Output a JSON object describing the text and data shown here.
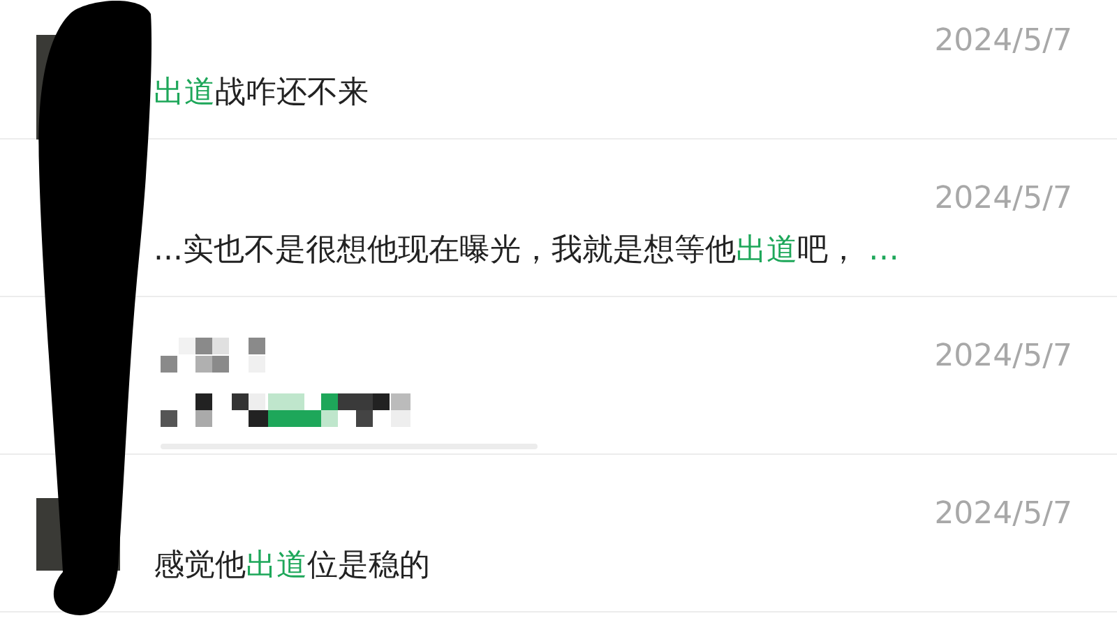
{
  "results": [
    {
      "kind": "message",
      "date": "2024/5/7",
      "segments": [
        {
          "kind": "keyword",
          "text": "出道"
        },
        {
          "kind": "plain",
          "text": "战咋还不来"
        }
      ]
    },
    {
      "kind": "message",
      "date": "2024/5/7",
      "segments": [
        {
          "kind": "plain",
          "text": "...实也不是很想他现在曝光，我就是想等他"
        },
        {
          "kind": "keyword",
          "text": "出道"
        },
        {
          "kind": "plain",
          "text": "吧，"
        },
        {
          "kind": "keyword",
          "text": " …"
        }
      ]
    },
    {
      "kind": "pixelated",
      "date": "2024/5/7"
    },
    {
      "kind": "message",
      "date": "2024/5/7",
      "segments": [
        {
          "kind": "plain",
          "text": "感觉他"
        },
        {
          "kind": "keyword",
          "text": "出道"
        },
        {
          "kind": "plain",
          "text": "位是稳的"
        }
      ]
    }
  ]
}
